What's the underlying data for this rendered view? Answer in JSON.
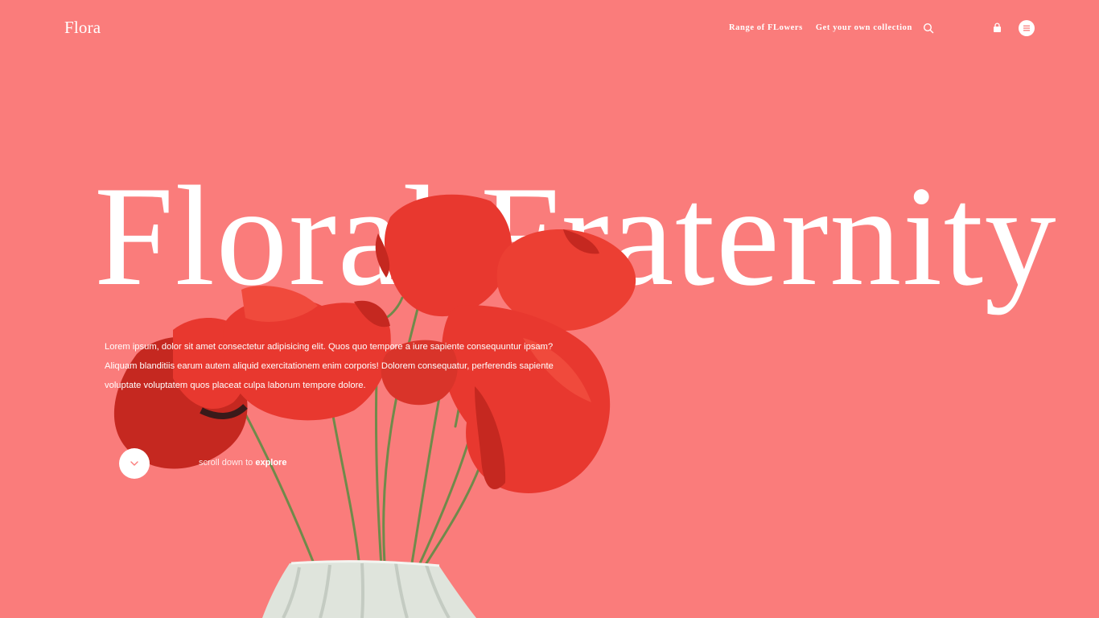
{
  "header": {
    "logo": "Flora",
    "nav": [
      {
        "label": "Range of FLowers"
      },
      {
        "label": "Get your own collection"
      }
    ],
    "icons": {
      "search": "search-icon",
      "bag": "bag-icon",
      "menu": "hamburger-menu-icon"
    }
  },
  "hero": {
    "title": "Floral Fraternity",
    "description": "Lorem ipsum, dolor sit amet consectetur adipisicing elit. Quos quo tempore a iure sapiente consequuntur ipsam? Aliquam blanditiis earum autem aliquid exercitationem enim corporis! Dolorem consequatur, perferendis sapiente voluptate voluptatem quos placeat culpa laborum tempore dolore.",
    "scroll_prefix": "scroll down to",
    "scroll_emphasis": "explore"
  },
  "colors": {
    "background": "#fa7c7b",
    "text": "#ffffff",
    "petal": "#e8382f",
    "petal_dark": "#c52820",
    "stem": "#6f8a4a",
    "vase": "#dfe4dc"
  }
}
